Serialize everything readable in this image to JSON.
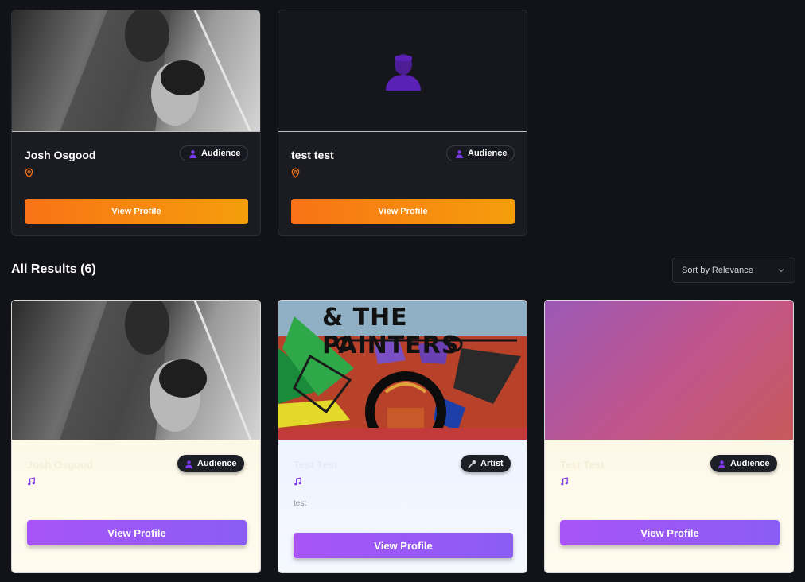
{
  "featured": [
    {
      "name": "Josh Osgood",
      "role": "Audience",
      "button": "View Profile"
    },
    {
      "name": "test test",
      "role": "Audience",
      "button": "View Profile"
    }
  ],
  "results": {
    "heading": "All Results (6)",
    "sort": {
      "selected": "Sort by Relevance"
    },
    "cards": [
      {
        "name": "Josh Osgood",
        "role": "Audience",
        "role_icon": "person-icon",
        "description": "",
        "button": "View Profile"
      },
      {
        "name": "Test Test",
        "role": "Artist",
        "role_icon": "microphone-icon",
        "description": "test",
        "button": "View Profile",
        "banner_text": "& THE PAINTERS"
      },
      {
        "name": "Test Test",
        "role": "Audience",
        "role_icon": "person-icon",
        "description": "",
        "button": "View Profile"
      }
    ]
  },
  "colors": {
    "background": "#121318",
    "card_dark": "#1b1c22",
    "accent_orange": "#f97316",
    "accent_purple": "#8b5cf6",
    "role_icon": "#7c3aed",
    "pin": "#f97316"
  }
}
